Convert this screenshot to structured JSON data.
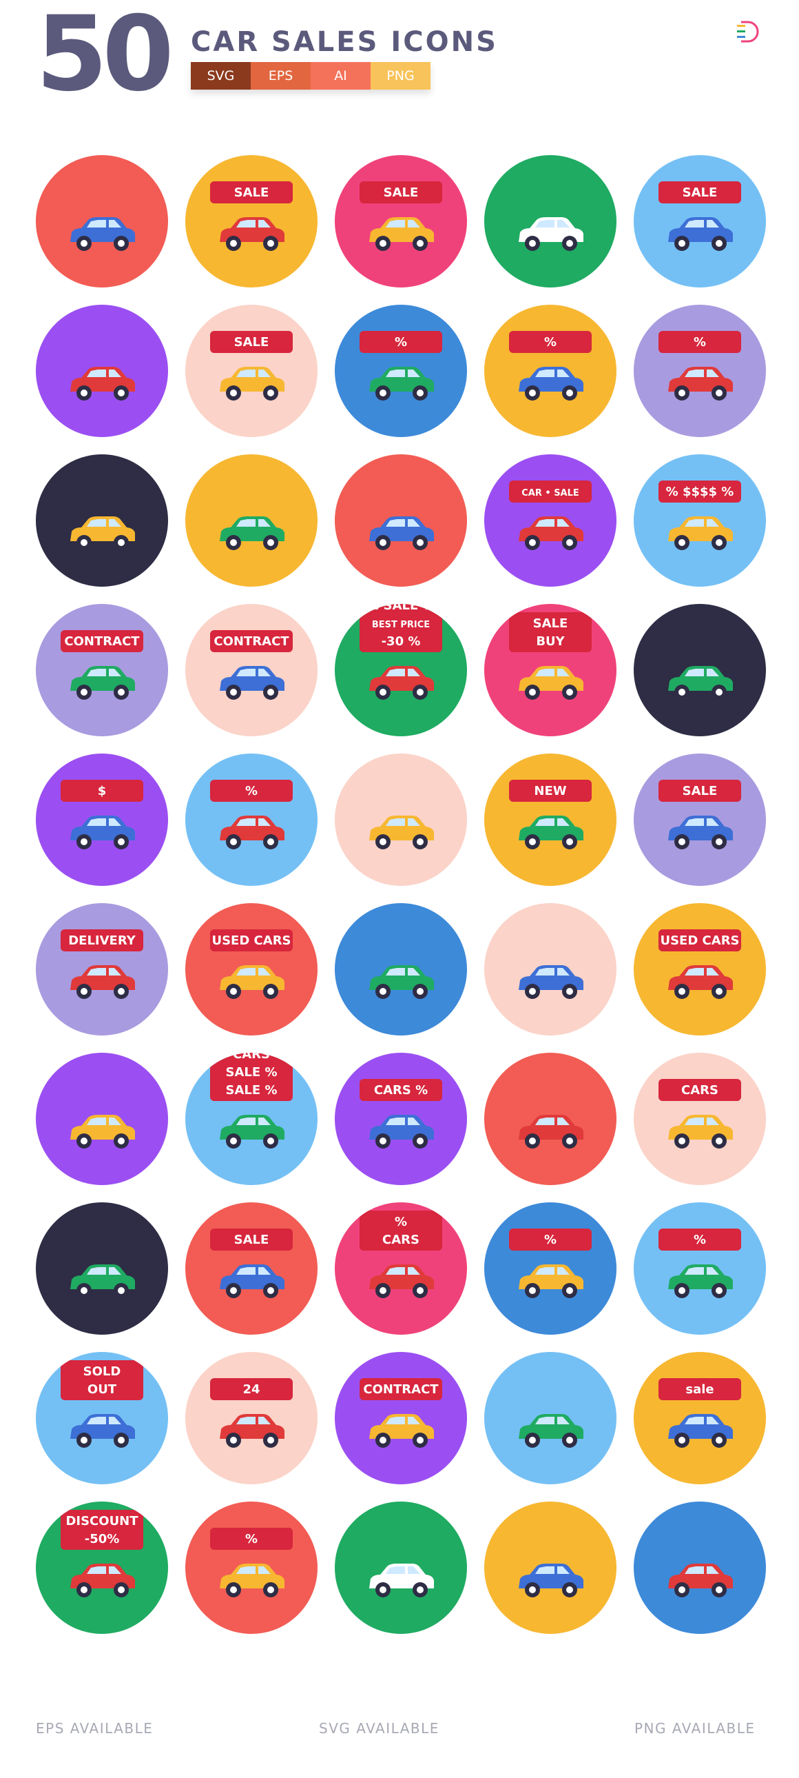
{
  "header": {
    "count": "50",
    "title": "CAR SALES ICONS",
    "formats": [
      {
        "label": "SVG",
        "color": "#8b3a1e"
      },
      {
        "label": "EPS",
        "color": "#e2663f"
      },
      {
        "label": "AI",
        "color": "#f4725a"
      },
      {
        "label": "PNG",
        "color": "#f8c35a"
      }
    ]
  },
  "icons": [
    {
      "name": "hand-holding-car-key",
      "bg": "#f25c54"
    },
    {
      "name": "car-sale-tag",
      "bg": "#f7b731",
      "label": "SALE"
    },
    {
      "name": "car-key-sale-tag",
      "bg": "#f0427a",
      "label": "SALE"
    },
    {
      "name": "car-deal-handshake",
      "bg": "#1fab62"
    },
    {
      "name": "car-sale-tag-red",
      "bg": "#74c0f5",
      "label": "SALE"
    },
    {
      "name": "salesman-avatar",
      "bg": "#9b4ff2"
    },
    {
      "name": "sale-delivery-truck",
      "bg": "#fbd3c8",
      "label": "SALE"
    },
    {
      "name": "car-discount-percent",
      "bg": "#3d8ad9",
      "label": "%"
    },
    {
      "name": "online-car-purchase",
      "bg": "#f7b731",
      "label": "%"
    },
    {
      "name": "car-key-discount-tag",
      "bg": "#a99be0",
      "label": "%"
    },
    {
      "name": "saleswoman-avatar",
      "bg": "#2e2d45"
    },
    {
      "name": "hand-offering-car",
      "bg": "#f7b731"
    },
    {
      "name": "hand-with-car-key",
      "bg": "#f25c54"
    },
    {
      "name": "car-sale-banner-lot",
      "bg": "#9b4ff2",
      "label": "CAR • SALE"
    },
    {
      "name": "car-price-sign",
      "bg": "#74c0f5",
      "label": "% $$$$ %"
    },
    {
      "name": "contract-with-cash",
      "bg": "#a99be0",
      "label": "CONTRACT"
    },
    {
      "name": "contract-with-pen",
      "bg": "#fbd3c8",
      "label": "CONTRACT"
    },
    {
      "name": "monitor-sale-best-price",
      "bg": "#1fab62",
      "lines": [
        "% SALE %",
        "BEST PRICE",
        "-30 %"
      ]
    },
    {
      "name": "phone-sale-buy",
      "bg": "#f0427a",
      "lines": [
        "SALE",
        "BUY"
      ]
    },
    {
      "name": "money-and-car-key",
      "bg": "#2e2d45"
    },
    {
      "name": "car-dollar-pin",
      "bg": "#9b4ff2",
      "label": "$"
    },
    {
      "name": "hand-discount-badge",
      "bg": "#74c0f5",
      "label": "%"
    },
    {
      "name": "car-into-basket",
      "bg": "#fbd3c8"
    },
    {
      "name": "new-convertible",
      "bg": "#f7b731",
      "label": "NEW"
    },
    {
      "name": "sale-billboard",
      "bg": "#a99be0",
      "label": "SALE"
    },
    {
      "name": "delivery-container",
      "bg": "#a99be0",
      "label": "DELIVERY"
    },
    {
      "name": "used-cars-showroom",
      "bg": "#f25c54",
      "label": "USED CARS"
    },
    {
      "name": "car-garage",
      "bg": "#3d8ad9"
    },
    {
      "name": "car-in-garage-door",
      "bg": "#fbd3c8"
    },
    {
      "name": "used-cars-lot",
      "bg": "#f7b731",
      "label": "USED CARS"
    },
    {
      "name": "car-insurance-shield",
      "bg": "#9b4ff2"
    },
    {
      "name": "sale-balloons",
      "bg": "#74c0f5",
      "lines": [
        "CARS",
        "SALE %",
        "SALE %"
      ]
    },
    {
      "name": "cars-price-tag",
      "bg": "#9b4ff2",
      "label": "CARS %"
    },
    {
      "name": "electric-car-battery",
      "bg": "#f25c54"
    },
    {
      "name": "cars-dealership",
      "bg": "#fbd3c8",
      "label": "CARS"
    },
    {
      "name": "finger-select-car",
      "bg": "#2e2d45"
    },
    {
      "name": "sale-flags-car",
      "bg": "#f25c54",
      "label": "SALE"
    },
    {
      "name": "cars-shop-discount-pin",
      "bg": "#f0427a",
      "lines": [
        "%",
        "CARS"
      ]
    },
    {
      "name": "price-down-car",
      "bg": "#3d8ad9",
      "label": "%"
    },
    {
      "name": "car-discount-pin",
      "bg": "#74c0f5",
      "label": "%"
    },
    {
      "name": "sold-out-camper",
      "bg": "#74c0f5",
      "lines": [
        "SOLD",
        "OUT"
      ]
    },
    {
      "name": "24-hour-support-phone",
      "bg": "#fbd3c8",
      "label": "24"
    },
    {
      "name": "contract-with-card",
      "bg": "#9b4ff2",
      "label": "CONTRACT"
    },
    {
      "name": "cash-and-credit-card",
      "bg": "#74c0f5"
    },
    {
      "name": "sale-coupon",
      "bg": "#f7b731",
      "label": "sale"
    },
    {
      "name": "discount-convertible",
      "bg": "#1fab62",
      "lines": [
        "DISCOUNT",
        "-50%"
      ]
    },
    {
      "name": "clipboard-discount",
      "bg": "#f25c54",
      "label": "%"
    },
    {
      "name": "hand-car-and-key",
      "bg": "#1fab62"
    },
    {
      "name": "online-car-rating",
      "bg": "#f7b731"
    },
    {
      "name": "cash-for-key-exchange",
      "bg": "#3d8ad9"
    }
  ],
  "footer": {
    "eps": "EPS AVAILABLE",
    "svg": "SVG AVAILABLE",
    "png": "PNG AVAILABLE"
  }
}
